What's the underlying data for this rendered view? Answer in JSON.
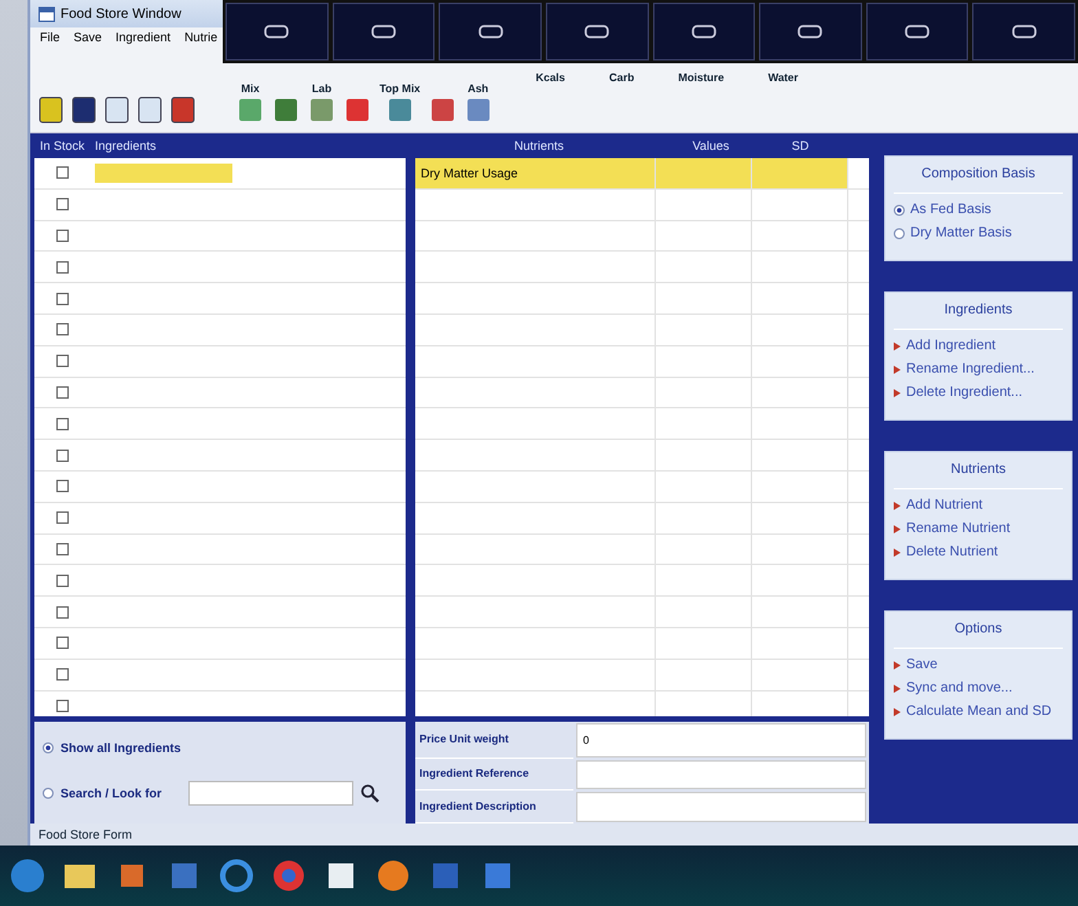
{
  "window": {
    "title": "Food Store Window"
  },
  "menu": [
    "File",
    "Save",
    "Ingredient",
    "Nutrie"
  ],
  "toolbar": {
    "labels": [
      "Mix",
      "Lab",
      "Top Mix",
      "Ash",
      "Kcals",
      "Carb",
      "Moisture",
      "Water"
    ]
  },
  "ingredients_table": {
    "columns": [
      "In Stock",
      "Ingredients"
    ],
    "rows": [
      {
        "checked": false,
        "selected": true
      },
      {
        "checked": false,
        "selected": false
      },
      {
        "checked": false,
        "selected": false
      },
      {
        "checked": false,
        "selected": false
      },
      {
        "checked": false,
        "selected": false
      },
      {
        "checked": false,
        "selected": false
      },
      {
        "checked": false,
        "selected": false
      },
      {
        "checked": false,
        "selected": false
      },
      {
        "checked": false,
        "selected": false
      },
      {
        "checked": false,
        "selected": false
      },
      {
        "checked": false,
        "selected": false
      },
      {
        "checked": false,
        "selected": false
      },
      {
        "checked": false,
        "selected": false
      },
      {
        "checked": false,
        "selected": false
      },
      {
        "checked": false,
        "selected": false
      },
      {
        "checked": false,
        "selected": false
      },
      {
        "checked": false,
        "selected": false
      },
      {
        "checked": false,
        "selected": false
      }
    ]
  },
  "nutrients_table": {
    "columns": [
      "Nutrients",
      "Values",
      "SD"
    ],
    "rows": [
      {
        "name": "Dry Matter Usage",
        "selected": true
      }
    ]
  },
  "ingredient_filter": [
    {
      "label": "Show all Ingredients",
      "selected": true
    },
    {
      "label": "Search / Look for",
      "selected": false
    }
  ],
  "details": [
    {
      "label": "Price Unit weight",
      "value": "0"
    },
    {
      "label": "Ingredient Reference"
    },
    {
      "label": "Ingredient Description"
    }
  ],
  "side_panels": [
    {
      "title": "Composition Basis",
      "kind": "radio",
      "items": [
        {
          "label": "As Fed Basis",
          "selected": true
        },
        {
          "label": "Dry Matter Basis",
          "selected": false
        }
      ]
    },
    {
      "title": "Ingredients",
      "kind": "actions",
      "items": [
        {
          "label": "Add Ingredient"
        },
        {
          "label": "Rename Ingredient..."
        },
        {
          "label": "Delete Ingredient..."
        }
      ]
    },
    {
      "title": "Nutrients",
      "kind": "actions",
      "items": [
        {
          "label": "Add Nutrient"
        },
        {
          "label": "Rename Nutrient"
        },
        {
          "label": "Delete Nutrient"
        }
      ]
    },
    {
      "title": "Options",
      "kind": "actions",
      "items": [
        {
          "label": "Save"
        },
        {
          "label": "Sync and move..."
        },
        {
          "label": "Calculate Mean and SD"
        }
      ]
    }
  ],
  "status_bar": "Food Store Form"
}
